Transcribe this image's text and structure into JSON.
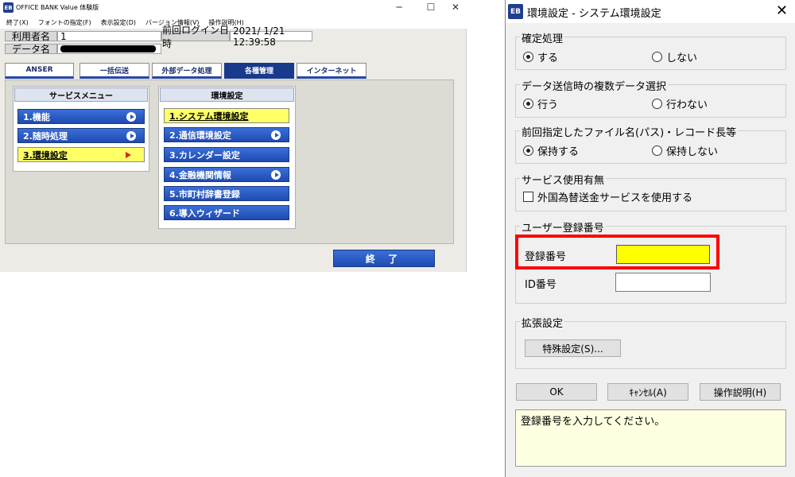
{
  "main_window": {
    "title": "OFFICE BANK Value 体験版",
    "logo_text": "EB",
    "menu": [
      "終了(X)",
      "フォントの指定(F)",
      "表示設定(D)",
      "バージョン情報(V)",
      "操作説明(H)"
    ],
    "user_label": "利用者名",
    "user_value": "1",
    "last_login_label": "前回ログイン日時",
    "last_login_value": "2021/ 1/21 12:39:58",
    "data_label": "データ名",
    "tabs": [
      "ANSER",
      "一括伝送",
      "外部データ処理",
      "各種管理",
      "インターネット"
    ],
    "active_tab": "各種管理",
    "service_menu": {
      "header": "サービスメニュー",
      "items": [
        "1.機能",
        "2.随時処理",
        "3.環境設定"
      ]
    },
    "env_menu": {
      "header": "環境設定",
      "items": [
        "1.システム環境設定",
        "2.通信環境設定",
        "3.カレンダー設定",
        "4.金融機関情報",
        "5.市町村辞書登録",
        "6.導入ウィザード"
      ]
    },
    "end_button": "終 了"
  },
  "dialog": {
    "title": "環境設定 - システム環境設定",
    "logo_text": "EB",
    "groups": {
      "confirm": {
        "label": "確定処理",
        "opt1": "する",
        "opt2": "しない",
        "selected": 1
      },
      "multi_select": {
        "label": "データ送信時の複数データ選択",
        "opt1": "行う",
        "opt2": "行わない",
        "selected": 1
      },
      "filename": {
        "label": "前回指定したファイル名(パス)・レコード長等",
        "opt1": "保持する",
        "opt2": "保持しない",
        "selected": 1
      },
      "service": {
        "label": "サービス使用有無",
        "checkbox": "外国為替送金サービスを使用する",
        "checked": false
      },
      "user_reg": {
        "label": "ユーザー登録番号",
        "reg_no_label": "登録番号",
        "id_label": "ID番号",
        "reg_no_value": "",
        "id_value": ""
      },
      "extended": {
        "label": "拡張設定",
        "button": "特殊設定(S)..."
      }
    },
    "buttons": {
      "ok": "OK",
      "cancel": "ｷｬﾝｾﾙ(A)",
      "help": "操作説明(H)"
    },
    "message": "登録番号を入力してください。"
  }
}
